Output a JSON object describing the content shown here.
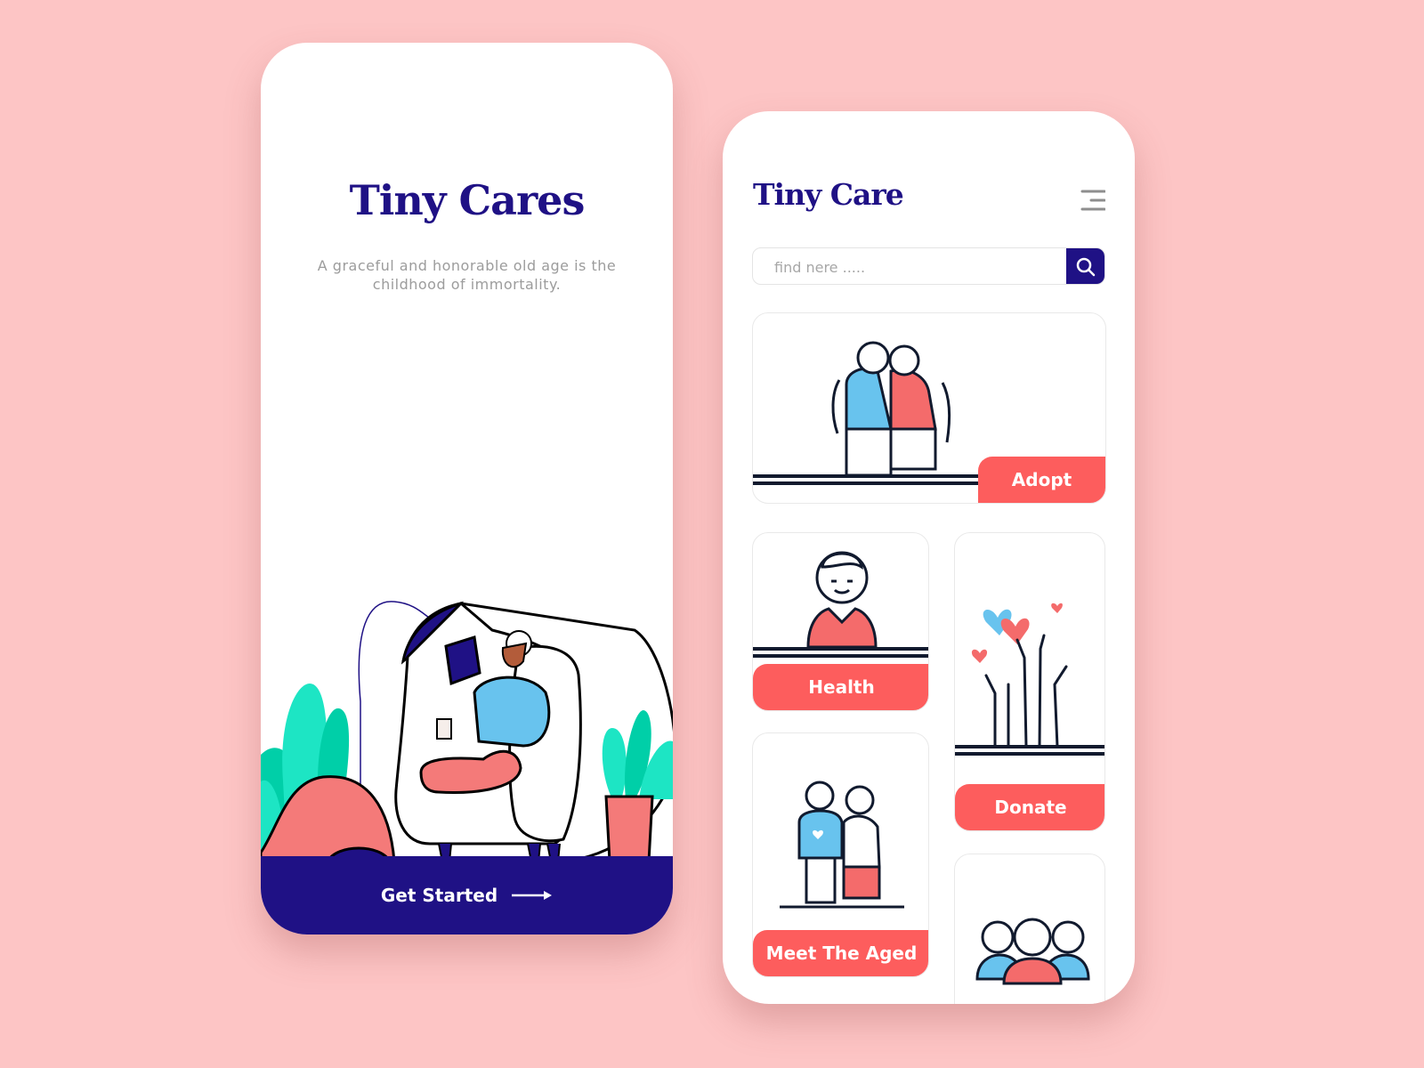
{
  "colors": {
    "background": "#fdc5c5",
    "brand_navy": "#1f1185",
    "accent_coral": "#fd5d5d",
    "subtitle_gray": "#9c9c9c",
    "illustration_blue": "#68c3ee",
    "illustration_teal": "#1de5c4"
  },
  "onboarding": {
    "title": "Tiny Cares",
    "subtitle": "A graceful and honorable old age is the childhood of immortality.",
    "illustration": "elderly-man-reading-in-armchair",
    "cta": {
      "label": "Get Started",
      "icon": "arrow-right-icon"
    }
  },
  "home": {
    "title": "Tiny Care",
    "menu_icon": "hamburger-menu-icon",
    "search": {
      "placeholder": "find nere .....",
      "value": "",
      "icon": "search-icon"
    },
    "cards": [
      {
        "id": "adopt",
        "label": "Adopt",
        "illustration": "elderly-couple-icon"
      },
      {
        "id": "health",
        "label": "Health",
        "illustration": "doctor-icon"
      },
      {
        "id": "donate",
        "label": "Donate",
        "illustration": "raised-hands-hearts-icon"
      },
      {
        "id": "meet",
        "label": "Meet The Aged",
        "illustration": "young-man-with-elder-icon"
      },
      {
        "id": "community",
        "label": "",
        "illustration": "group-of-people-icon"
      }
    ]
  }
}
